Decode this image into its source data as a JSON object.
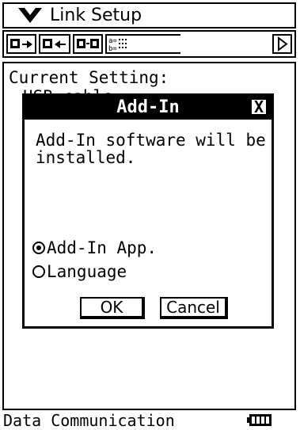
{
  "titlebar": {
    "title": "Link Setup",
    "menu_icon": "chevron-down-icon"
  },
  "toolbar": {
    "buttons": [
      "send-icon",
      "receive-icon",
      "link-icon",
      "alpha-grid-icon"
    ],
    "more_icon": "scroll-right-icon"
  },
  "main": {
    "current_setting_label": "Current Setting:",
    "current_setting_value": "USB cable"
  },
  "dialog": {
    "title": "Add-In",
    "message_line1": "Add-In software will be",
    "message_line2": "installed.",
    "options": [
      {
        "label": "Add-In App.",
        "selected": true
      },
      {
        "label": "Language",
        "selected": false
      }
    ],
    "ok_label": "OK",
    "cancel_label": "Cancel",
    "close_label": "X"
  },
  "statusbar": {
    "text": "Data Communication",
    "battery_icon": "battery-icon"
  }
}
